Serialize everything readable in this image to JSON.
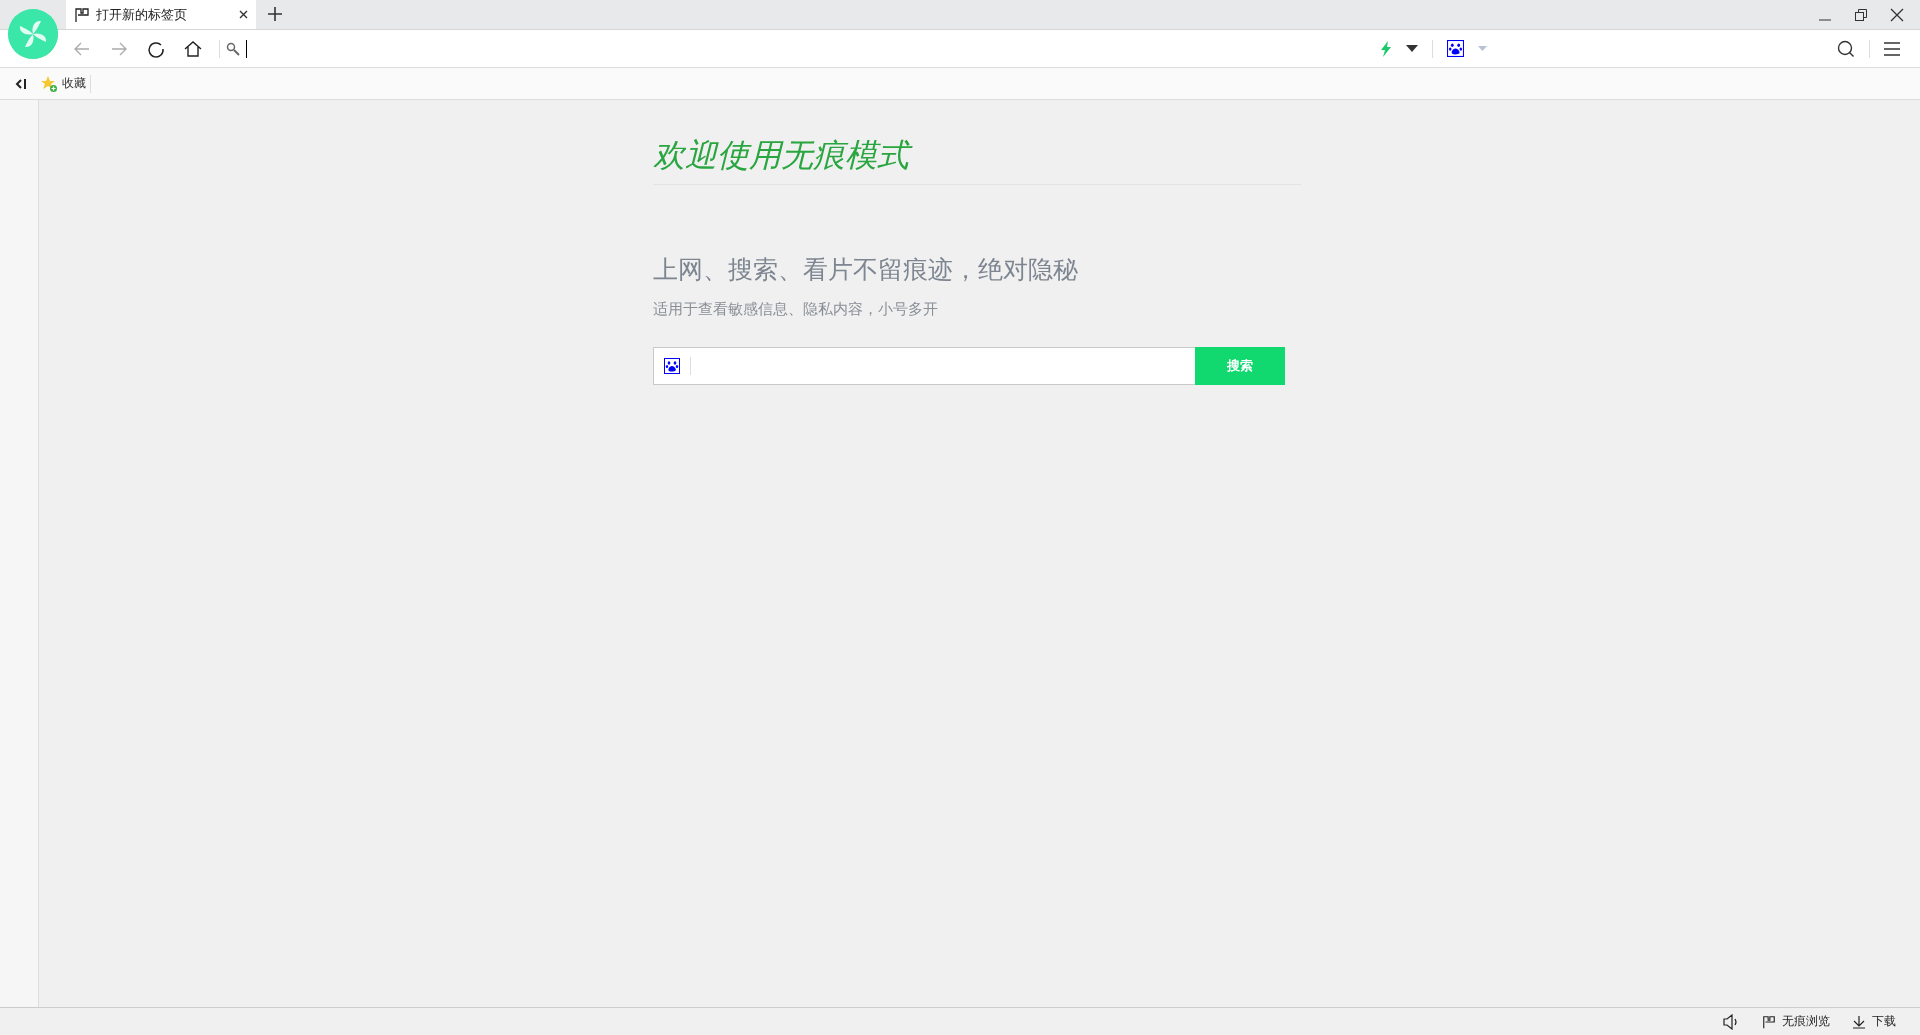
{
  "tabs": [
    {
      "title": "打开新的标签页",
      "selected": true
    }
  ],
  "bookmarks_bar": {
    "items": [
      "收藏"
    ]
  },
  "page": {
    "title": "欢迎使用无痕模式",
    "headline": "上网、搜索、看片不留痕迹，绝对隐秘",
    "subtitle": "适用于查看敏感信息、隐私内容，小号多开",
    "search_button": "搜索"
  },
  "status_bar": {
    "items": [
      {
        "kind": "incognito",
        "label": "无痕浏览"
      },
      {
        "kind": "download",
        "label": "下载"
      }
    ]
  }
}
